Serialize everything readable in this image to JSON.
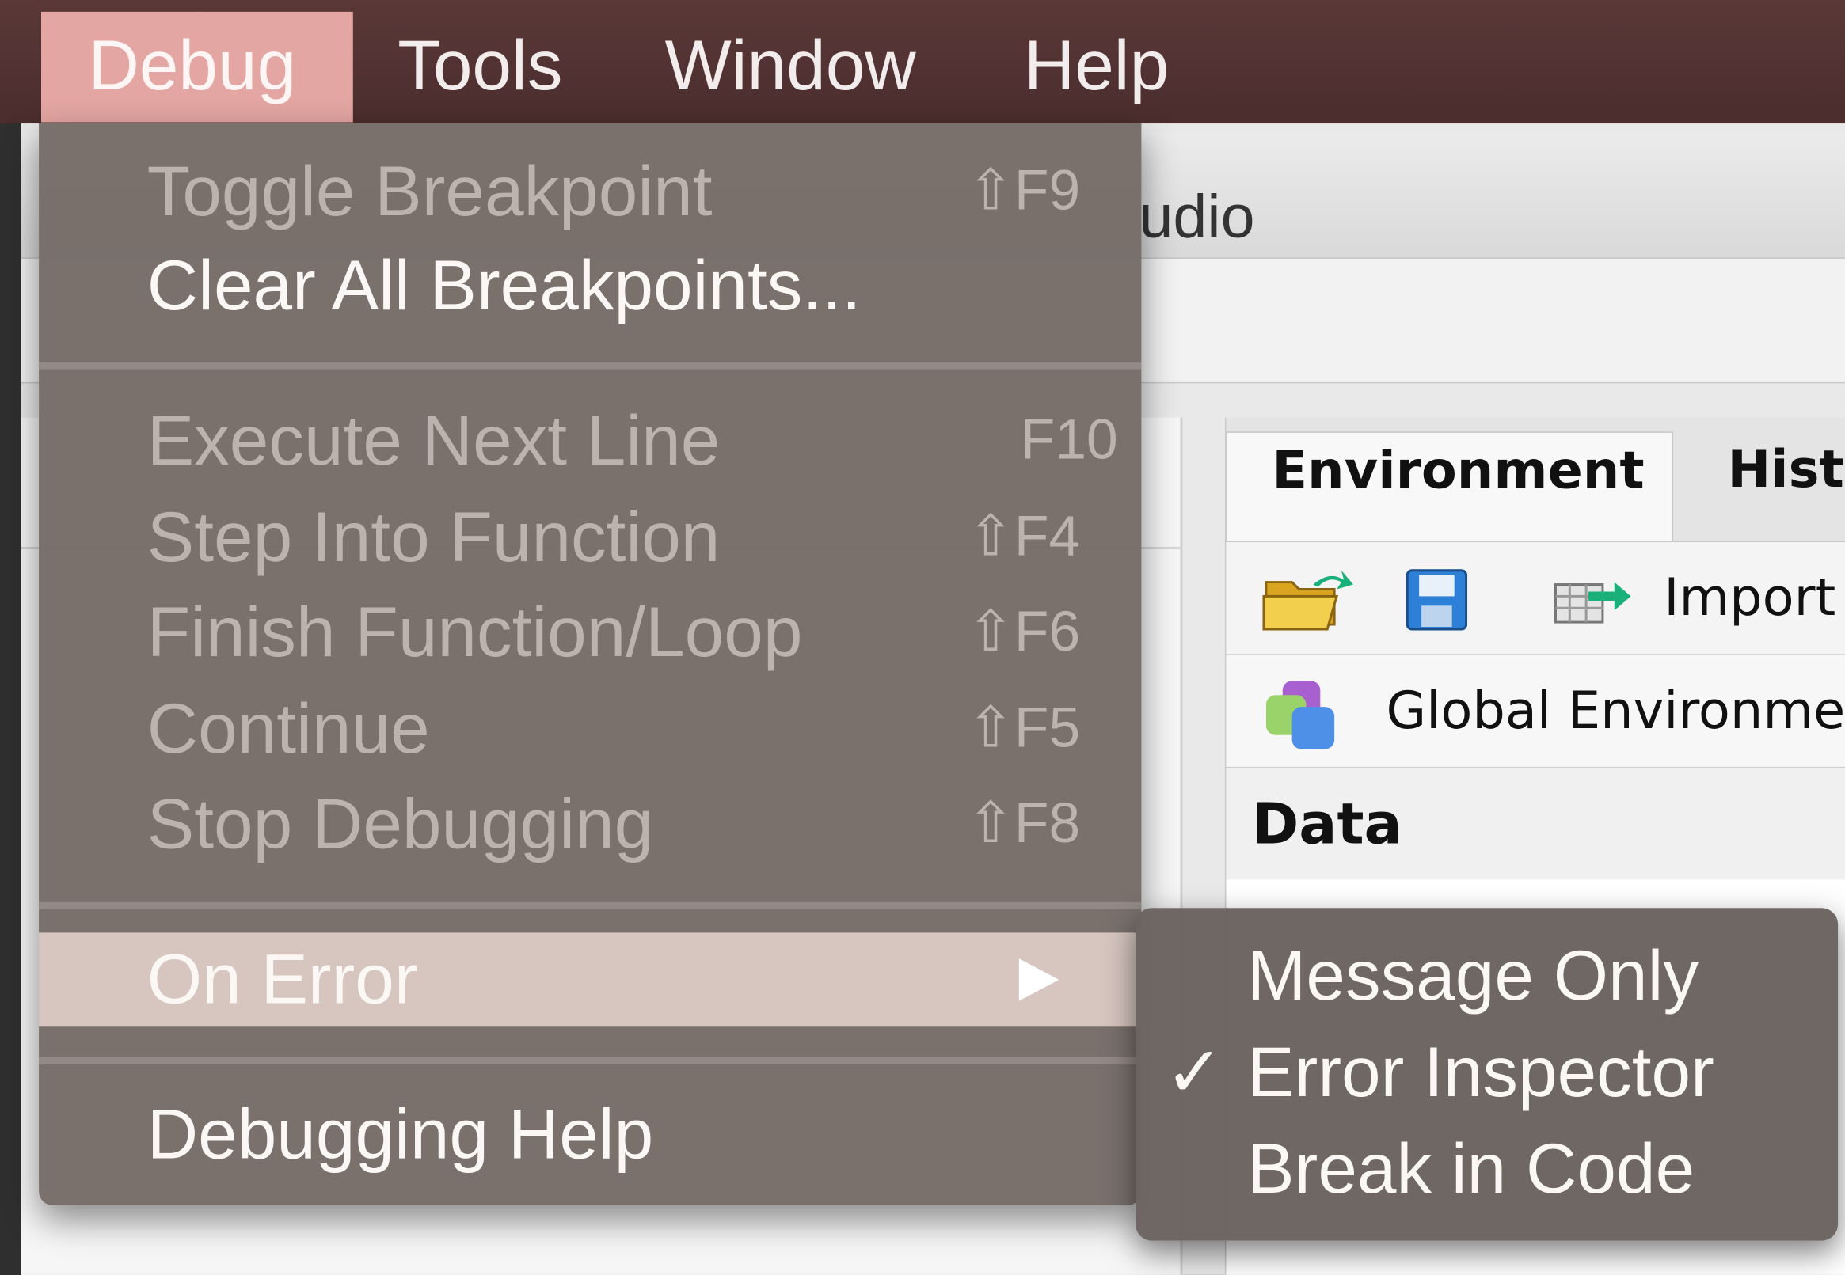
{
  "menubar": {
    "items": [
      {
        "label": "Debug"
      },
      {
        "label": "Tools"
      },
      {
        "label": "Window"
      },
      {
        "label": "Help"
      }
    ]
  },
  "background_app": {
    "title_fragment": "udio",
    "tabs": [
      "Environment",
      "Histo"
    ],
    "toolbar": {
      "import_label": "Import"
    },
    "scope_label": "Global Environmen",
    "section_header": "Data"
  },
  "debug_menu": {
    "items": [
      {
        "label": "Toggle Breakpoint",
        "shortcut": "⇧F9",
        "enabled": false
      },
      {
        "label": "Clear All Breakpoints...",
        "shortcut": "",
        "enabled": true
      },
      {
        "label": "Execute Next Line",
        "shortcut": "F10",
        "enabled": false
      },
      {
        "label": "Step Into Function",
        "shortcut": "⇧F4",
        "enabled": false
      },
      {
        "label": "Finish Function/Loop",
        "shortcut": "⇧F6",
        "enabled": false
      },
      {
        "label": "Continue",
        "shortcut": "⇧F5",
        "enabled": false
      },
      {
        "label": "Stop Debugging",
        "shortcut": "⇧F8",
        "enabled": false
      },
      {
        "label": "On Error",
        "shortcut": "",
        "enabled": true,
        "submenu": true
      },
      {
        "label": "Debugging Help",
        "shortcut": "",
        "enabled": true
      }
    ]
  },
  "on_error_submenu": {
    "items": [
      {
        "label": "Message Only",
        "checked": false
      },
      {
        "label": "Error Inspector",
        "checked": true
      },
      {
        "label": "Break in Code",
        "checked": false
      }
    ],
    "check_mark": "✓"
  },
  "colors": {
    "menubar_bg": "#4b2d2d",
    "active_menu_bg": "#e3a6a2",
    "menu_bg": "#766c68",
    "highlight_bg": "#d6c6bf"
  }
}
